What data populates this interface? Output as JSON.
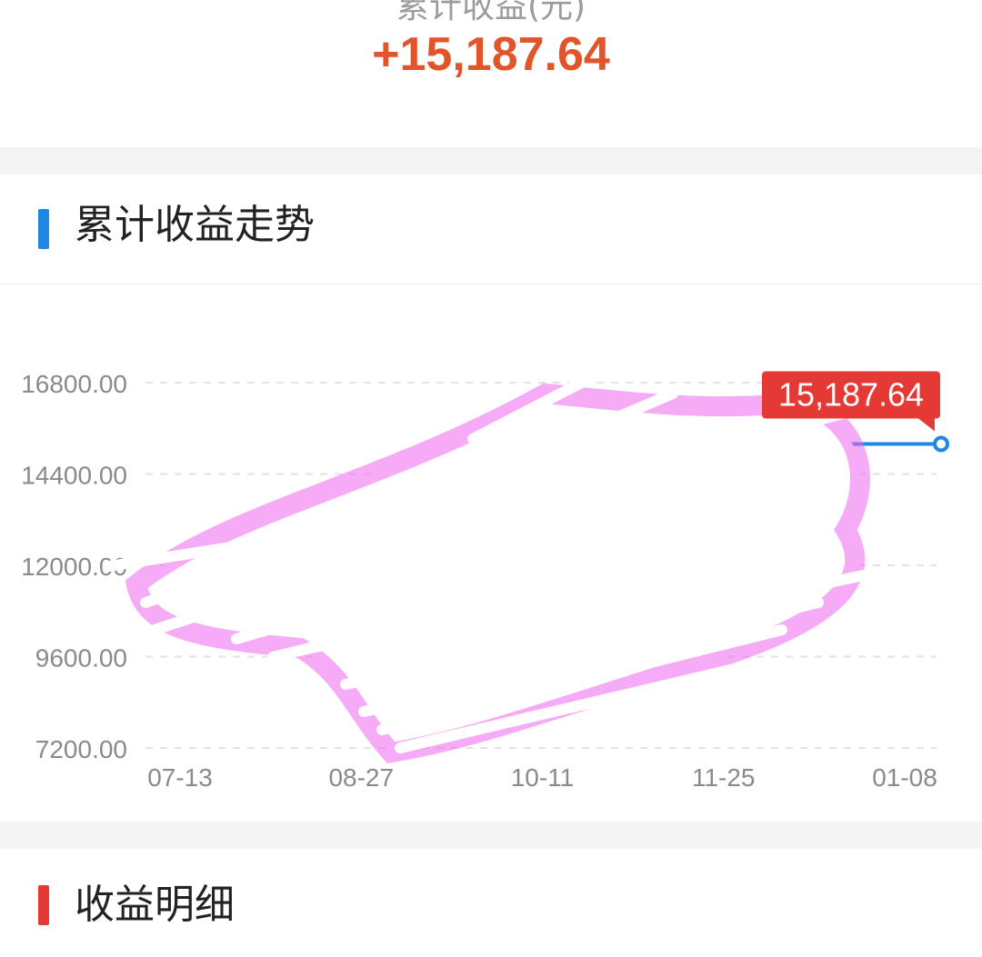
{
  "summary": {
    "caption": "累计收益(元)",
    "value": "+15,187.64"
  },
  "trend_section": {
    "title": "累计收益走势",
    "accent_color": "#1e88e5"
  },
  "detail_section": {
    "title": "收益明细",
    "accent_color": "#e53935"
  },
  "chart_data": {
    "type": "line",
    "title": "",
    "xlabel": "",
    "ylabel": "",
    "x_tick_labels": [
      "07-13",
      "08-27",
      "10-11",
      "11-25",
      "01-08"
    ],
    "y_tick_labels": [
      "16800.00",
      "14400.00",
      "12000.00",
      "9600.00",
      "7200.00"
    ],
    "y_ticks": [
      16800,
      14400,
      12000,
      9600,
      7200
    ],
    "ylim": [
      7200,
      16800
    ],
    "grid": "dashed horizontal",
    "series": [
      {
        "color": "#1e88e5",
        "visible_points": [
          {
            "x": "01-08",
            "y": 15187.64
          }
        ]
      }
    ],
    "end_label": "15,187.64",
    "end_label_color": "#e53935",
    "note_obscured": "most of the line is covered by scribbles"
  }
}
